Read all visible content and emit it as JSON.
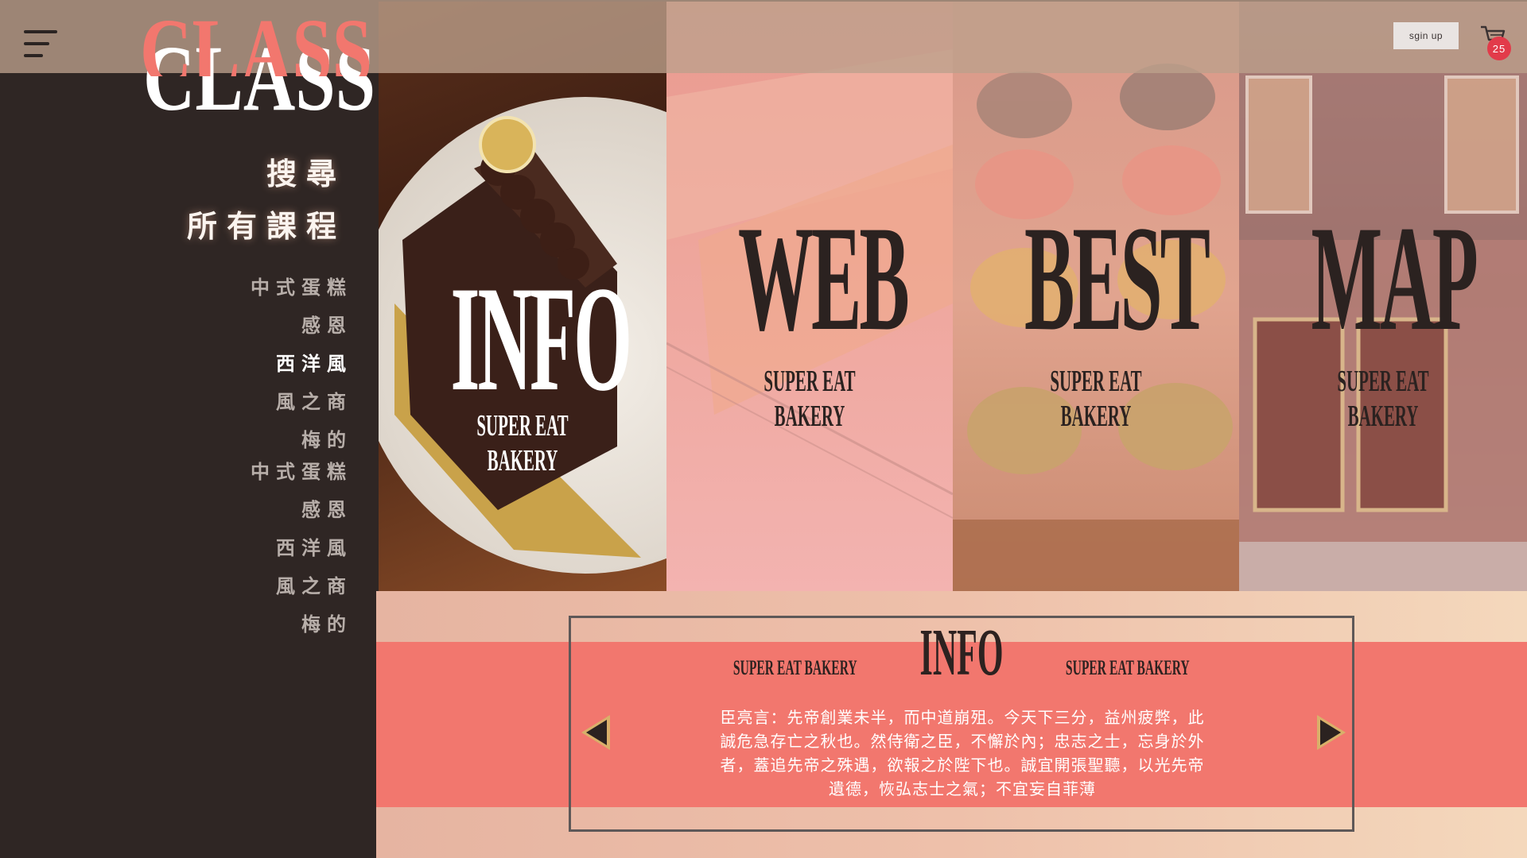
{
  "header": {
    "menu_icon": "hamburger-menu-icon",
    "signup_label": "sgin up",
    "cart_icon": "shopping-cart-icon",
    "cart_count": "25"
  },
  "sidebar": {
    "title": "CLASS",
    "search_label": "搜尋",
    "all_courses_label": "所有課程",
    "categories": [
      {
        "label": "中式蛋糕",
        "active": false
      },
      {
        "label": "感恩",
        "active": false
      },
      {
        "label": "西洋風",
        "active": true
      },
      {
        "label": "風之商",
        "active": false
      },
      {
        "label": "梅的",
        "active": false
      },
      {
        "label": "中式蛋糕",
        "active": false
      },
      {
        "label": "感恩",
        "active": false
      },
      {
        "label": "西洋風",
        "active": false
      },
      {
        "label": "風之商",
        "active": false
      },
      {
        "label": "梅的",
        "active": false
      }
    ]
  },
  "panels": [
    {
      "title": "INFO",
      "subtitle": "SUPER EAT BAKERY"
    },
    {
      "title": "WEB",
      "subtitle": "SUPER EAT BAKERY"
    },
    {
      "title": "BEST",
      "subtitle": "SUPER EAT BAKERY"
    },
    {
      "title": "MAP",
      "subtitle": "SUPER EAT BAKERY"
    }
  ],
  "carousel": {
    "title": "INFO",
    "subtitle_left": "SUPER EAT BAKERY",
    "subtitle_right": "SUPER EAT BAKERY",
    "text": "臣亮言：先帝創業未半，而中道崩殂。今天下三分，益州疲弊，此誠危急存亡之秋也。然侍衛之臣，不懈於內；忠志之士，忘身於外者，蓋追先帝之殊遇，欲報之於陛下也。誠宜開張聖聽，以光先帝遺德，恢弘志士之氣；不宜妄自菲薄",
    "prev_icon": "triangle-left-icon",
    "next_icon": "triangle-right-icon"
  },
  "colors": {
    "accent": "#f2776e",
    "sidebar": "#2f2624",
    "badge": "#e23b4a"
  }
}
